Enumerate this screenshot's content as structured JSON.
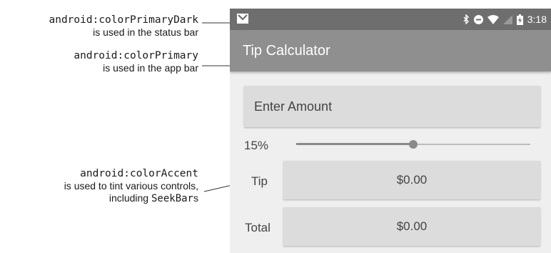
{
  "annotations": {
    "primary_dark": {
      "attribute": "android:colorPrimaryDark",
      "description": "is used in the status bar"
    },
    "primary": {
      "attribute": "android:colorPrimary",
      "description": "is used in the app bar"
    },
    "accent": {
      "attribute": "android:colorAccent",
      "description_line1": "is used to tint various controls,",
      "description_line2_prefix": "including ",
      "description_line2_code": "SeekBar",
      "description_line2_suffix": "s"
    }
  },
  "status_bar": {
    "icons": [
      "gmail-icon",
      "bluetooth-icon",
      "do-not-disturb-icon",
      "wifi-icon",
      "cell-signal-icon",
      "battery-charging-icon"
    ],
    "time": "3:18"
  },
  "app_bar": {
    "title": "Tip Calculator"
  },
  "form": {
    "amount_placeholder": "Enter Amount",
    "percent_label": "15%",
    "seekbar_value_percent": 15,
    "seekbar_max_percent": 30,
    "tip_label": "Tip",
    "tip_value": "$0.00",
    "total_label": "Total",
    "total_value": "$0.00"
  },
  "colors": {
    "status_bar": "#6e6e6e",
    "app_bar": "#8f8f8f",
    "background": "#efefef",
    "field_background": "#dcdcdc",
    "accent": "#8a8a8a"
  }
}
